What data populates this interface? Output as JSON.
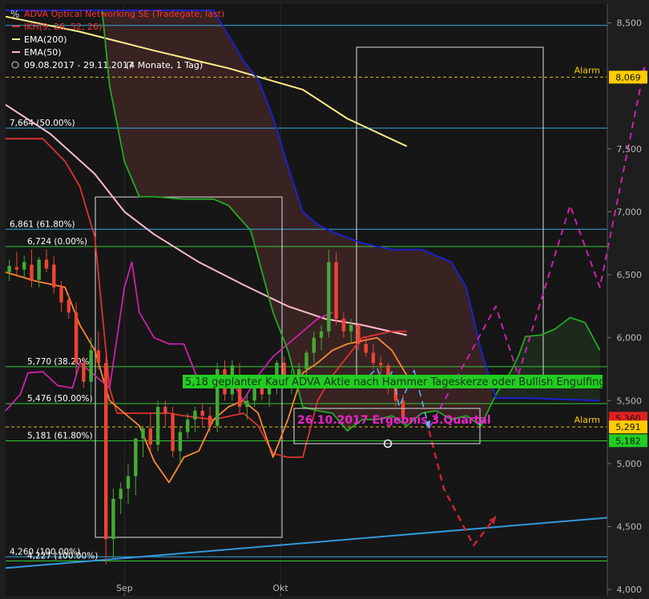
{
  "header": {
    "title": "ADVA Optical Networking SE (Tradegate, last)",
    "indicators": [
      {
        "label": "IKH(9, 26, 52, 26)",
        "color": "#ff3333"
      },
      {
        "label": "EMA(200)",
        "color": "#ffee88"
      },
      {
        "label": "EMA(50)",
        "color": "#ffbbcc"
      }
    ],
    "period": "09.08.2017 - 29.11.2017",
    "period_note": "(4 Monate, 1 Tag)"
  },
  "chart_data": {
    "type": "candlestick",
    "ylim": [
      3.95,
      8.65
    ],
    "x_range": [
      0,
      81
    ],
    "x_ticks": [
      {
        "x": 16,
        "label": "Sep"
      },
      {
        "x": 37,
        "label": "Okt"
      }
    ],
    "y_ticks": [
      {
        "v": 8.5,
        "label": "8,500"
      },
      {
        "v": 7.5,
        "label": "7,500"
      },
      {
        "v": 7.0,
        "label": "7,000"
      },
      {
        "v": 6.5,
        "label": "6,500"
      },
      {
        "v": 6.0,
        "label": "6,000"
      },
      {
        "v": 5.5,
        "label": "5,500"
      },
      {
        "v": 5.0,
        "label": "5,000"
      },
      {
        "v": 4.5,
        "label": "4,500"
      },
      {
        "v": 4.0,
        "label": "4,000"
      }
    ],
    "price_tags": [
      {
        "v": 8.069,
        "label": "8,069",
        "bg": "#ffcc00"
      },
      {
        "v": 5.36,
        "label": "5,360",
        "bg": "#e02020"
      },
      {
        "v": 5.291,
        "label": "5,291",
        "bg": "#ffcc00"
      },
      {
        "v": 5.182,
        "label": "5,182",
        "bg": "#22cc22"
      }
    ],
    "alarms": [
      {
        "v": 8.069,
        "label": "Alarm"
      },
      {
        "v": 5.291,
        "label": "Alarm"
      }
    ],
    "fib_levels": [
      {
        "v": 8.48,
        "label": "",
        "color": "#33aadd"
      },
      {
        "v": 7.664,
        "label": "7,664 (50.00%)",
        "color": "#33aadd"
      },
      {
        "v": 6.861,
        "label": "6,861 (61.80%)",
        "color": "#33aadd"
      },
      {
        "v": 6.724,
        "label": "6,724 (0.00%)",
        "color": "#33cc33"
      },
      {
        "v": 5.77,
        "label": "5,770 (38.20%)",
        "color": "#33cc33"
      },
      {
        "v": 5.476,
        "label": "5,476 (50.00%)",
        "color": "#33cc33"
      },
      {
        "v": 5.181,
        "label": "5,181 (61.80%)",
        "color": "#33cc33"
      },
      {
        "v": 4.26,
        "label": "4,260 (100.00%)",
        "color": "#33aadd"
      },
      {
        "v": 4.227,
        "label": "4,227 (100.00%)",
        "color": "#33cc33"
      }
    ],
    "annotations": {
      "plan_text": "5,18  geplanter Kauf ADVA Aktie nach Hammer Tageskerze  oder Bullish Engulfing",
      "earnings_text": "26.10.2017  Ergebnis 3.Quartal"
    },
    "candles": [
      [
        6.52,
        6.62,
        6.45,
        6.57
      ],
      [
        6.56,
        6.68,
        6.5,
        6.54
      ],
      [
        6.54,
        6.65,
        6.48,
        6.6
      ],
      [
        6.58,
        6.7,
        6.4,
        6.45
      ],
      [
        6.46,
        6.64,
        6.4,
        6.62
      ],
      [
        6.62,
        6.7,
        6.52,
        6.55
      ],
      [
        6.58,
        6.65,
        6.35,
        6.4
      ],
      [
        6.4,
        6.45,
        6.2,
        6.28
      ],
      [
        6.3,
        6.35,
        6.15,
        6.2
      ],
      [
        6.2,
        6.28,
        5.7,
        5.8
      ],
      [
        5.8,
        5.85,
        5.6,
        5.65
      ],
      [
        5.65,
        6.0,
        5.55,
        5.9
      ],
      [
        5.9,
        6.05,
        5.75,
        5.8
      ],
      [
        5.8,
        5.85,
        4.2,
        4.4
      ],
      [
        4.4,
        4.8,
        4.25,
        4.72
      ],
      [
        4.72,
        4.85,
        4.6,
        4.8
      ],
      [
        4.8,
        5.0,
        4.68,
        4.9
      ],
      [
        4.9,
        5.1,
        4.75,
        5.2
      ],
      [
        5.2,
        5.3,
        5.05,
        5.28
      ],
      [
        5.28,
        5.4,
        5.1,
        5.15
      ],
      [
        5.15,
        5.5,
        5.1,
        5.45
      ],
      [
        5.45,
        5.5,
        5.3,
        5.4
      ],
      [
        5.4,
        5.45,
        5.05,
        5.1
      ],
      [
        5.1,
        5.3,
        5.0,
        5.25
      ],
      [
        5.25,
        5.4,
        5.2,
        5.35
      ],
      [
        5.35,
        5.45,
        5.25,
        5.42
      ],
      [
        5.42,
        5.48,
        5.3,
        5.38
      ],
      [
        5.38,
        5.45,
        5.25,
        5.3
      ],
      [
        5.3,
        5.8,
        5.25,
        5.75
      ],
      [
        5.75,
        5.82,
        5.5,
        5.55
      ],
      [
        5.55,
        5.82,
        5.5,
        5.78
      ],
      [
        5.7,
        5.8,
        5.4,
        5.45
      ],
      [
        5.45,
        5.55,
        5.35,
        5.5
      ],
      [
        5.5,
        5.65,
        5.45,
        5.6
      ],
      [
        5.6,
        5.7,
        5.5,
        5.55
      ],
      [
        5.55,
        5.65,
        5.45,
        5.6
      ],
      [
        5.6,
        5.82,
        5.55,
        5.8
      ],
      [
        5.8,
        5.85,
        5.6,
        5.65
      ],
      [
        5.65,
        5.75,
        5.55,
        5.7
      ],
      [
        5.7,
        5.8,
        5.6,
        5.75
      ],
      [
        5.75,
        5.9,
        5.7,
        5.88
      ],
      [
        5.88,
        6.05,
        5.8,
        6.0
      ],
      [
        6.0,
        6.1,
        5.9,
        6.05
      ],
      [
        6.05,
        6.7,
        6.0,
        6.6
      ],
      [
        6.6,
        6.68,
        6.1,
        6.15
      ],
      [
        6.15,
        6.2,
        6.0,
        6.05
      ],
      [
        6.05,
        6.15,
        5.95,
        6.1
      ],
      [
        6.1,
        6.12,
        5.9,
        5.95
      ],
      [
        5.95,
        6.0,
        5.85,
        5.88
      ],
      [
        5.88,
        5.95,
        5.75,
        5.8
      ],
      [
        5.8,
        5.85,
        5.7,
        5.78
      ],
      [
        5.78,
        5.8,
        5.55,
        5.6
      ],
      [
        5.6,
        5.65,
        5.45,
        5.5
      ],
      [
        5.5,
        5.55,
        5.33,
        5.36
      ]
    ],
    "series": [
      {
        "name": "EMA(200)",
        "color": "#ffee88",
        "width": 2,
        "points": [
          [
            0,
            8.55
          ],
          [
            10,
            8.43
          ],
          [
            20,
            8.28
          ],
          [
            30,
            8.14
          ],
          [
            40,
            7.97
          ],
          [
            46,
            7.74
          ],
          [
            50,
            7.63
          ],
          [
            54,
            7.52
          ]
        ]
      },
      {
        "name": "EMA(50)",
        "color": "#ffbbcc",
        "width": 2,
        "points": [
          [
            0,
            7.85
          ],
          [
            6,
            7.62
          ],
          [
            12,
            7.3
          ],
          [
            16,
            7.0
          ],
          [
            20,
            6.82
          ],
          [
            26,
            6.6
          ],
          [
            32,
            6.42
          ],
          [
            38,
            6.25
          ],
          [
            43,
            6.15
          ],
          [
            48,
            6.1
          ],
          [
            54,
            6.02
          ]
        ]
      },
      {
        "name": "Tenkan",
        "color": "#dd3333",
        "width": 1.8,
        "points": [
          [
            0,
            7.58
          ],
          [
            5,
            7.58
          ],
          [
            8,
            7.4
          ],
          [
            10,
            7.2
          ],
          [
            12,
            6.8
          ],
          [
            13,
            6.2
          ],
          [
            14,
            5.6
          ],
          [
            15,
            5.4
          ],
          [
            19,
            5.4
          ],
          [
            22,
            5.4
          ],
          [
            24,
            5.38
          ],
          [
            28,
            5.35
          ],
          [
            32,
            5.4
          ],
          [
            34,
            5.3
          ],
          [
            36,
            5.08
          ],
          [
            38,
            5.05
          ],
          [
            40,
            5.05
          ],
          [
            42,
            5.5
          ],
          [
            44,
            5.7
          ],
          [
            46,
            5.85
          ],
          [
            48,
            6.0
          ],
          [
            52,
            6.05
          ],
          [
            54,
            6.05
          ]
        ]
      },
      {
        "name": "Kijun",
        "color": "#ff8833",
        "width": 1.8,
        "points": [
          [
            0,
            6.52
          ],
          [
            4,
            6.45
          ],
          [
            8,
            6.4
          ],
          [
            10,
            6.1
          ],
          [
            12,
            5.9
          ],
          [
            14,
            5.5
          ],
          [
            16,
            5.4
          ],
          [
            18,
            5.3
          ],
          [
            20,
            5.02
          ],
          [
            22,
            4.85
          ],
          [
            24,
            5.05
          ],
          [
            26,
            5.1
          ],
          [
            28,
            5.35
          ],
          [
            30,
            5.45
          ],
          [
            32,
            5.5
          ],
          [
            34,
            5.4
          ],
          [
            36,
            5.05
          ],
          [
            38,
            5.35
          ],
          [
            40,
            5.72
          ],
          [
            42,
            5.8
          ],
          [
            44,
            5.9
          ],
          [
            46,
            5.95
          ],
          [
            50,
            6.0
          ],
          [
            52,
            5.9
          ],
          [
            54,
            5.7
          ]
        ]
      },
      {
        "name": "Chikou",
        "color": "#cc22aa",
        "width": 1.8,
        "points": [
          [
            0,
            5.42
          ],
          [
            2,
            5.55
          ],
          [
            3,
            5.72
          ],
          [
            5,
            5.73
          ],
          [
            7,
            5.62
          ],
          [
            9,
            5.6
          ],
          [
            10,
            5.8
          ],
          [
            12,
            5.7
          ],
          [
            14,
            5.6
          ],
          [
            16,
            6.4
          ],
          [
            17,
            6.6
          ],
          [
            18,
            6.2
          ],
          [
            20,
            6.0
          ],
          [
            22,
            5.95
          ],
          [
            24,
            5.95
          ],
          [
            26,
            5.65
          ],
          [
            28,
            5.65
          ],
          [
            30,
            5.7
          ],
          [
            32,
            5.5
          ],
          [
            34,
            5.7
          ],
          [
            36,
            5.85
          ],
          [
            38,
            5.95
          ],
          [
            40,
            6.05
          ],
          [
            42,
            6.15
          ],
          [
            44,
            6.2
          ]
        ]
      },
      {
        "name": "Senkou A",
        "color": "#22aa22",
        "width": 1.8,
        "points": [
          [
            0,
            8.6
          ],
          [
            9,
            8.6
          ],
          [
            13,
            8.6
          ],
          [
            14,
            8.0
          ],
          [
            16,
            7.4
          ],
          [
            18,
            7.12
          ],
          [
            20,
            7.12
          ],
          [
            24,
            7.1
          ],
          [
            28,
            7.1
          ],
          [
            30,
            7.05
          ],
          [
            33,
            6.85
          ],
          [
            36,
            6.2
          ],
          [
            38,
            5.9
          ],
          [
            40,
            5.45
          ],
          [
            42,
            5.42
          ],
          [
            44,
            5.4
          ],
          [
            46,
            5.26
          ],
          [
            48,
            5.35
          ],
          [
            50,
            5.35
          ],
          [
            52,
            5.38
          ],
          [
            54,
            5.3
          ],
          [
            56,
            5.4
          ],
          [
            58,
            5.42
          ],
          [
            60,
            5.35
          ],
          [
            62,
            5.38
          ],
          [
            64,
            5.3
          ],
          [
            66,
            5.55
          ],
          [
            68,
            5.73
          ],
          [
            69,
            5.85
          ],
          [
            70,
            6.01
          ],
          [
            72,
            6.02
          ],
          [
            74,
            6.07
          ],
          [
            76,
            6.16
          ],
          [
            78,
            6.12
          ],
          [
            80,
            5.9
          ]
        ]
      },
      {
        "name": "Senkou B",
        "color": "#1a22cc",
        "width": 2,
        "points": [
          [
            0,
            8.6
          ],
          [
            28,
            8.6
          ],
          [
            30,
            8.4
          ],
          [
            32,
            8.2
          ],
          [
            34,
            8.05
          ],
          [
            36,
            7.75
          ],
          [
            38,
            7.36
          ],
          [
            40,
            7.0
          ],
          [
            42,
            6.9
          ],
          [
            44,
            6.84
          ],
          [
            48,
            6.75
          ],
          [
            52,
            6.7
          ],
          [
            56,
            6.7
          ],
          [
            60,
            6.6
          ],
          [
            62,
            6.4
          ],
          [
            64,
            5.9
          ],
          [
            66,
            5.52
          ],
          [
            70,
            5.52
          ],
          [
            80,
            5.5
          ]
        ]
      },
      {
        "name": "Trend",
        "color": "#3399dd",
        "width": 2,
        "points": [
          [
            0,
            4.17
          ],
          [
            81,
            4.57
          ]
        ]
      }
    ],
    "forecast_paths": [
      {
        "color": "#cc22aa",
        "dashed": true,
        "width": 2,
        "points": [
          [
            57,
            5.28
          ],
          [
            66,
            6.25
          ],
          [
            69,
            5.7
          ],
          [
            76,
            7.05
          ],
          [
            80,
            6.4
          ],
          [
            86,
            8.15
          ]
        ]
      },
      {
        "color": "#cc2233",
        "dashed": true,
        "width": 2.5,
        "points": [
          [
            57,
            5.26
          ],
          [
            59,
            4.8
          ],
          [
            63,
            4.35
          ],
          [
            66,
            4.58
          ]
        ]
      },
      {
        "color": "#55bbff",
        "dashed": true,
        "width": 1.5,
        "points": [
          [
            49,
            5.7
          ],
          [
            50,
            5.76
          ],
          [
            51,
            5.6
          ],
          [
            52,
            5.73
          ],
          [
            53,
            5.45
          ],
          [
            55,
            5.74
          ],
          [
            57,
            5.28
          ]
        ]
      }
    ]
  }
}
